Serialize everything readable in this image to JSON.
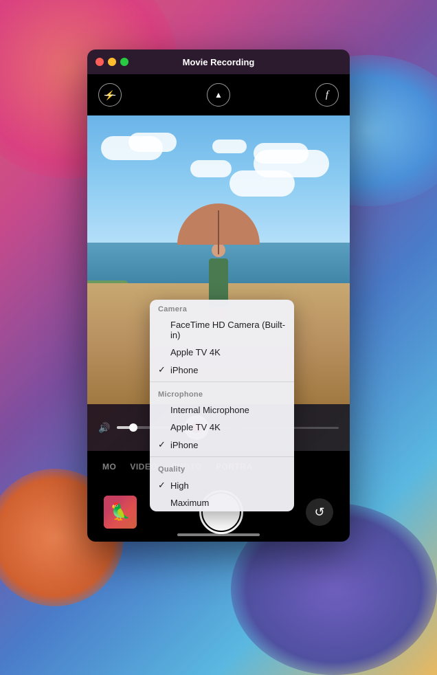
{
  "background": {
    "description": "macOS Big Sur gradient wallpaper"
  },
  "window": {
    "title": "Movie Recording",
    "traffic_lights": {
      "close": "close",
      "minimize": "minimize",
      "maximize": "maximize"
    }
  },
  "toolbar": {
    "flash_icon": "✕",
    "chevron_icon": "⌃",
    "font_icon": "ƒ"
  },
  "controls": {
    "timer": "--:--",
    "record_button": "record"
  },
  "mode_tabs": [
    {
      "label": "MO",
      "active": false
    },
    {
      "label": "VIDEO",
      "active": false
    },
    {
      "label": "PHOTO",
      "active": false
    },
    {
      "label": "PORTRA",
      "active": true
    }
  ],
  "dropdown": {
    "sections": [
      {
        "header": "Camera",
        "items": [
          {
            "label": "FaceTime HD Camera (Built-in)",
            "checked": false
          },
          {
            "label": "Apple TV 4K",
            "checked": false
          },
          {
            "label": "iPhone",
            "checked": true
          }
        ]
      },
      {
        "header": "Microphone",
        "items": [
          {
            "label": "Internal Microphone",
            "checked": false
          },
          {
            "label": "Apple TV 4K",
            "checked": false
          },
          {
            "label": "iPhone",
            "checked": true
          }
        ]
      },
      {
        "header": "Quality",
        "items": [
          {
            "label": "High",
            "checked": true
          },
          {
            "label": "Maximum",
            "checked": false
          }
        ]
      }
    ]
  }
}
